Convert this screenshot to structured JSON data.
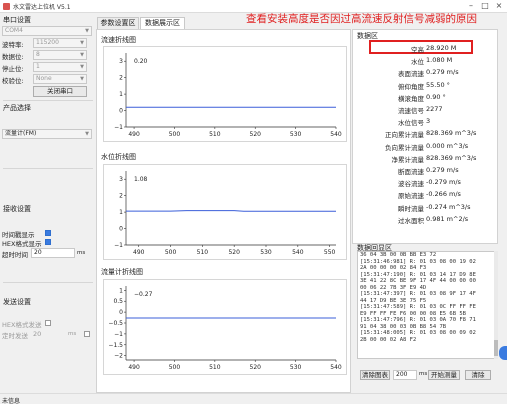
{
  "window": {
    "title": "水文雷达上位机 V5.1"
  },
  "annotation": "查看安装高度是否因过高流速反射信号减弱的原因",
  "serial": {
    "group_title": "串口设置",
    "port": "COM4",
    "baud_label": "波特率:",
    "baud_value": "115200",
    "data_label": "数据位:",
    "data_value": "8",
    "stop_label": "停止位:",
    "stop_value": "1",
    "parity_label": "校验位:",
    "parity_value": "None",
    "close_button": "关闭串口"
  },
  "product": {
    "group_title": "产品选择",
    "selected": "流量计(FM)"
  },
  "receive": {
    "group_title": "接收设置",
    "timestamp_label": "时间戳显示",
    "timestamp_checked": true,
    "hex_label": "HEX格式显示",
    "hex_checked": true,
    "timeout_label": "超时时间",
    "timeout_value": "20",
    "timeout_unit": "ms"
  },
  "send": {
    "group_title": "发送设置",
    "hex_send_label": "HEX格式发送",
    "hex_send_checked": false,
    "timed_send_label": "定时发送",
    "timed_send_value": "20",
    "timed_send_unit": "ms",
    "timed_send_checked": false
  },
  "tabs": [
    {
      "label": "参数设置区",
      "active": false
    },
    {
      "label": "数据展示区",
      "active": true
    }
  ],
  "charts": [
    {
      "title": "流速折线图",
      "value_label": "0.20",
      "yticks": [
        "3",
        "2",
        "1",
        "0",
        "−1"
      ],
      "xticks": [
        "490",
        "500",
        "510",
        "520",
        "530",
        "540"
      ]
    },
    {
      "title": "水位折线图",
      "value_label": "1.08",
      "yticks": [
        "3",
        "2",
        "1",
        "0",
        "−1"
      ],
      "xticks": [
        "490",
        "500",
        "510",
        "520",
        "530",
        "540",
        "550"
      ]
    },
    {
      "title": "流量计折线图",
      "value_label": "−0.27",
      "yticks": [
        "1",
        "0.5",
        "0",
        "−0.5",
        "−1",
        "−1.5",
        "−2"
      ],
      "xticks": [
        "490",
        "500",
        "510",
        "520",
        "530",
        "540"
      ]
    }
  ],
  "chart_data": [
    {
      "type": "line",
      "title": "流速折线图",
      "x": [
        488,
        540
      ],
      "y": [
        0.2,
        0.2
      ],
      "ylim": [
        -1,
        3.5
      ],
      "xlim": [
        488,
        540
      ]
    },
    {
      "type": "line",
      "title": "水位折线图",
      "x": [
        486,
        500,
        505,
        520,
        523,
        552
      ],
      "y": [
        1.06,
        1.06,
        1.09,
        1.09,
        1.05,
        1.05
      ],
      "ylim": [
        -1,
        3.5
      ],
      "xlim": [
        486,
        552
      ]
    },
    {
      "type": "line",
      "title": "流量计折线图",
      "x": [
        488,
        540
      ],
      "y": [
        -0.27,
        -0.27
      ],
      "ylim": [
        -2.2,
        1.2
      ],
      "xlim": [
        488,
        540
      ]
    }
  ],
  "data_area": {
    "title": "数据区",
    "rows": [
      {
        "label": "空高",
        "value": "28.920 M"
      },
      {
        "label": "水位",
        "value": "1.080 M"
      },
      {
        "label": "表面流速",
        "value": "0.279 m/s"
      },
      {
        "label": "俯仰角度",
        "value": "55.50 °"
      },
      {
        "label": "横滚角度",
        "value": "0.90 °"
      },
      {
        "label": "流速信号",
        "value": "2277"
      },
      {
        "label": "水位信号",
        "value": "3"
      },
      {
        "label": "正向累计流量",
        "value": "828.369 m^3/s"
      },
      {
        "label": "负向累计流量",
        "value": "0.000 m^3/s"
      },
      {
        "label": "净累计流量",
        "value": "828.369 m^3/s"
      },
      {
        "label": "断面流速",
        "value": "0.279 m/s"
      },
      {
        "label": "波谷流速",
        "value": "-0.279 m/s"
      },
      {
        "label": "原始流速",
        "value": "-0.266 m/s"
      },
      {
        "label": "瞬时流量",
        "value": "-0.274 m^3/s"
      },
      {
        "label": "过水面积",
        "value": "0.981 m^2/s"
      }
    ]
  },
  "log_area": {
    "title": "数据回显区",
    "lines": [
      "36 04 3B 00 0B BB E3 72",
      "[15:31:46:981] R: 01 03 08 00 19 02",
      "2A 00 00 00 02 84 F3",
      "[15:31:47:190] R: 01 03 14 17 D9 8E",
      "3E 41 22 8C BE 9F 17 4F 44 00 00 00",
      "00 06 22 7B 3F E9 4D",
      "[15:31:47:397] R: 01 03 08 9F 17 4F",
      "44 17 D9 BE 3E 75 F5",
      "[15:31:47:589] R: 01 03 0C FF FF FE",
      "E9 FF FF FE F6 00 00 08 E5 6B 5B",
      "[15:31:47:796] R: 01 03 0A 70 F8 71",
      "91 04 38 00 03 0B B8 54 7B",
      "[15:31:48:005] R: 01 03 08 00 09 02",
      "2B 00 00 02 A8 F2"
    ],
    "clear_chart_button": "清除图表",
    "interval_value": "200",
    "interval_unit": "ms",
    "start_button": "开始测量",
    "clear_button": "清除"
  },
  "status_text": "未信息"
}
